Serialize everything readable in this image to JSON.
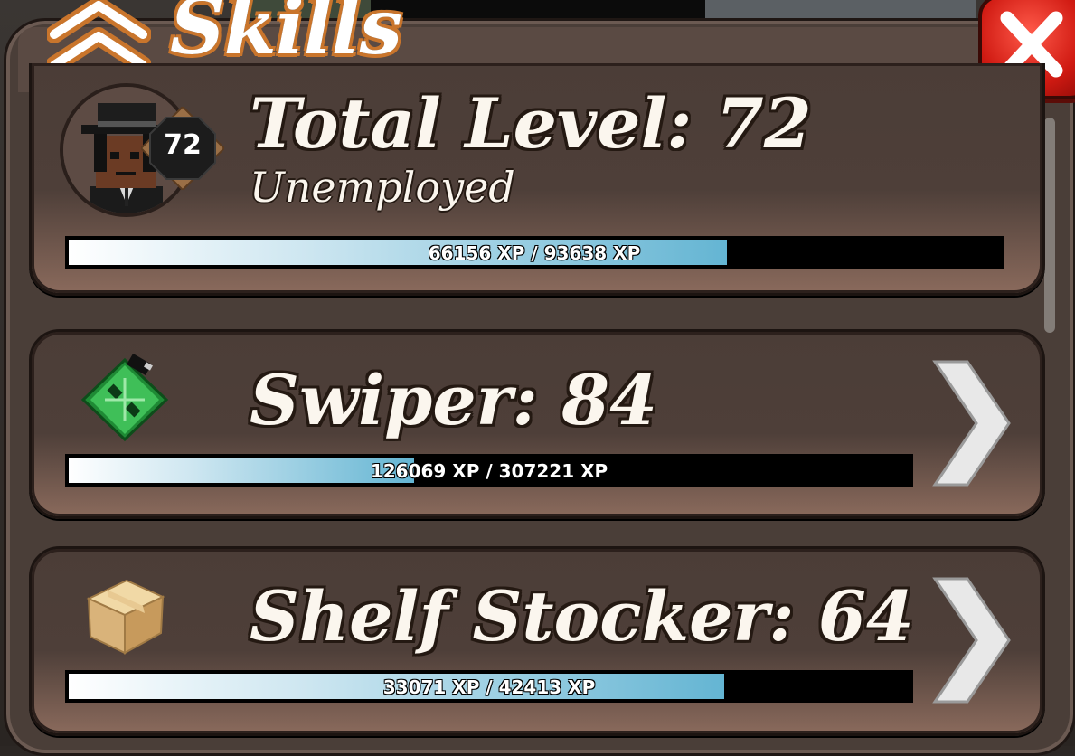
{
  "header": {
    "title": "Skills"
  },
  "total": {
    "title": "Total Level: 72",
    "occupation": "Unemployed",
    "badge_level": "72",
    "xp_text": "66156 XP / 93638 XP",
    "xp_current": 66156,
    "xp_max": 93638
  },
  "skills": [
    {
      "title": "Swiper: 84",
      "icon": "circuit-board-icon",
      "xp_text": "126069 XP / 307221 XP",
      "xp_current": 126069,
      "xp_max": 307221
    },
    {
      "title": "Shelf Stocker: 64",
      "icon": "cardboard-box-icon",
      "xp_text": "33071 XP / 42413 XP",
      "xp_current": 33071,
      "xp_max": 42413
    }
  ],
  "colors": {
    "panel": "#4a3e38",
    "close": "#d01a12",
    "title_outline": "#c9752c",
    "xp_fill": "#64b5d3"
  }
}
